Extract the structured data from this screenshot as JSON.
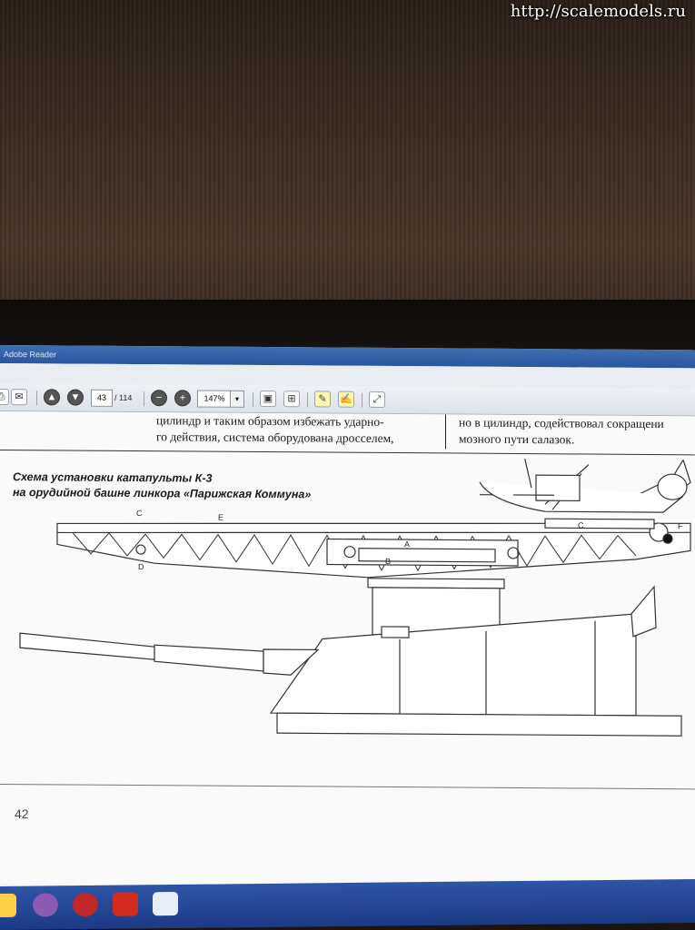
{
  "watermark": "http://scalemodels.ru",
  "window": {
    "title": "Adobe Reader"
  },
  "toolbar": {
    "page_current": "43",
    "page_total": "/ 114",
    "zoom": "147%",
    "zoom_dropdown_icon": "chevron-down-icon"
  },
  "document": {
    "left_column": [
      "цилиндр и таким образом избежать ударно-",
      "го действия, система оборудована дросселем,"
    ],
    "right_column": [
      "но в цилиндр, содействовал сокращени",
      "мозного пути салазок."
    ],
    "caption_line1": "Схема установки катапульты К-3",
    "caption_line2": "на орудийной башне линкора «Парижская Коммуна»",
    "labels": {
      "c1": "C",
      "e": "E",
      "d": "D",
      "c2": "C",
      "f": "F",
      "a": "A",
      "b": "B"
    },
    "page_number": "42"
  },
  "colors": {
    "titlebar": "#2a55a0",
    "taskbar": "#1c3a84",
    "page": "#fafafa"
  }
}
